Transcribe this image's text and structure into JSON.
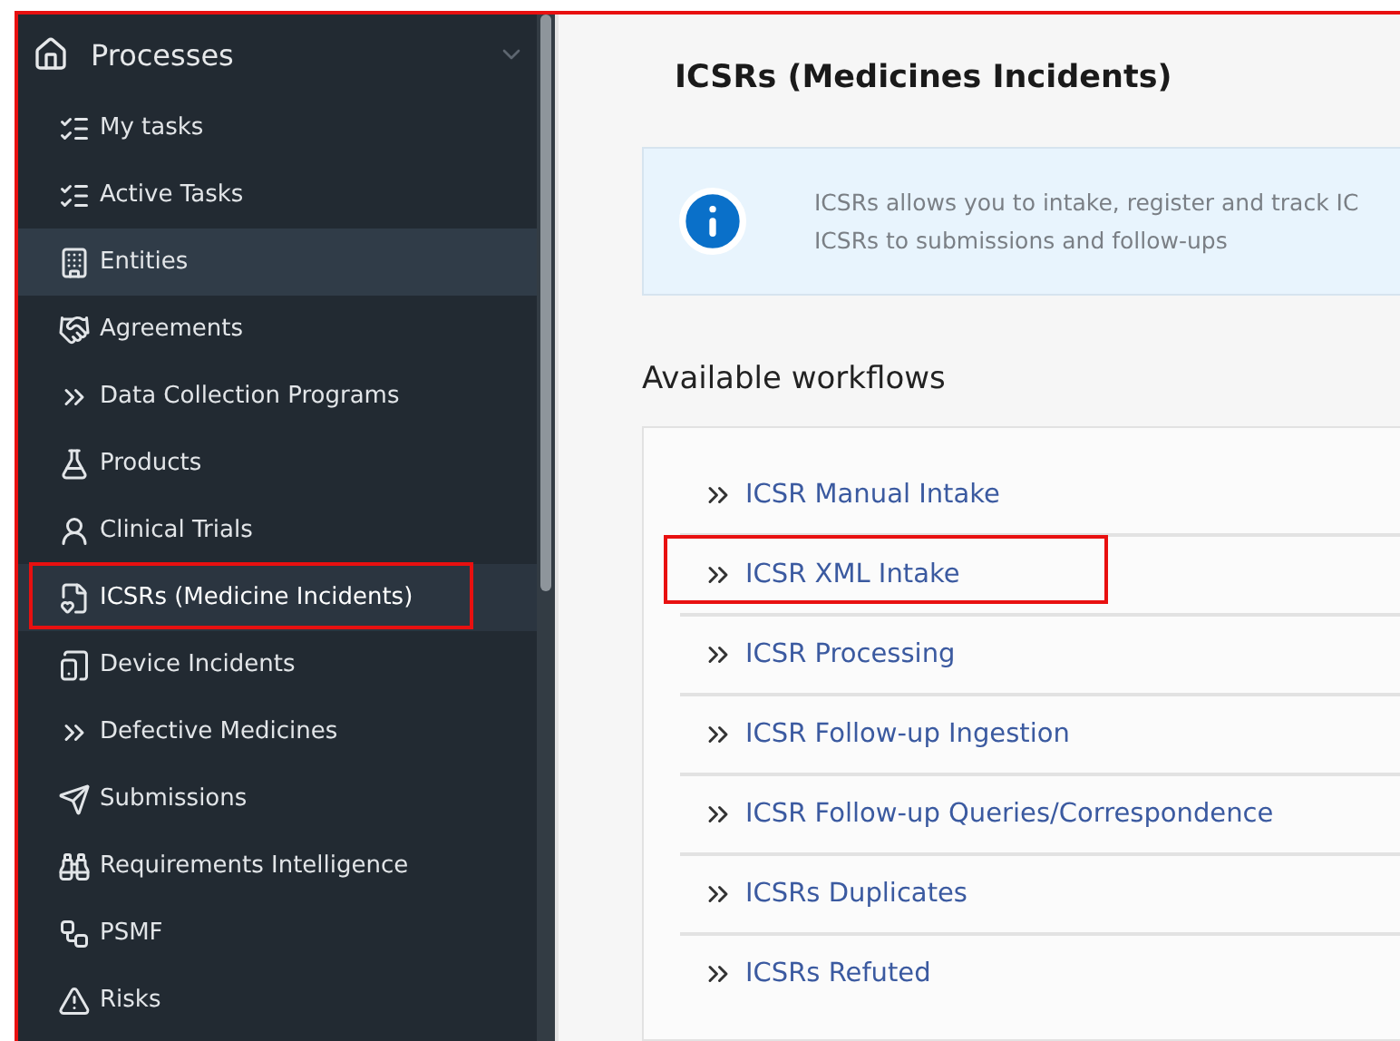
{
  "sidebar": {
    "header": "Processes",
    "expanded": true,
    "items": [
      {
        "label": "My tasks",
        "selected": false,
        "hovered": false,
        "highlighted": false
      },
      {
        "label": "Active Tasks",
        "selected": false,
        "hovered": false,
        "highlighted": false
      },
      {
        "label": "Entities",
        "selected": false,
        "hovered": true,
        "highlighted": false
      },
      {
        "label": "Agreements",
        "selected": false,
        "hovered": false,
        "highlighted": false
      },
      {
        "label": "Data Collection Programs",
        "selected": false,
        "hovered": false,
        "highlighted": false
      },
      {
        "label": "Products",
        "selected": false,
        "hovered": false,
        "highlighted": false
      },
      {
        "label": "Clinical Trials",
        "selected": false,
        "hovered": false,
        "highlighted": false
      },
      {
        "label": "ICSRs (Medicine Incidents)",
        "selected": true,
        "hovered": false,
        "highlighted": true
      },
      {
        "label": "Device Incidents",
        "selected": false,
        "hovered": false,
        "highlighted": false
      },
      {
        "label": "Defective Medicines",
        "selected": false,
        "hovered": false,
        "highlighted": false
      },
      {
        "label": "Submissions",
        "selected": false,
        "hovered": false,
        "highlighted": false
      },
      {
        "label": "Requirements Intelligence",
        "selected": false,
        "hovered": false,
        "highlighted": false
      },
      {
        "label": "PSMF",
        "selected": false,
        "hovered": false,
        "highlighted": false
      },
      {
        "label": "Risks",
        "selected": false,
        "hovered": false,
        "highlighted": false
      }
    ]
  },
  "main": {
    "title": "ICSRs (Medicines Incidents)",
    "info": {
      "lines": [
        "ICSRs allows you to intake, register and track IC",
        "ICSRs to submissions and follow-ups"
      ]
    },
    "workflows_heading": "Available workflows",
    "workflows": [
      {
        "label": "ICSR Manual Intake",
        "highlighted": false
      },
      {
        "label": "ICSR XML Intake",
        "highlighted": true
      },
      {
        "label": "ICSR Processing",
        "highlighted": false
      },
      {
        "label": "ICSR Follow-up Ingestion",
        "highlighted": false
      },
      {
        "label": "ICSR Follow-up Queries/Correspondence",
        "highlighted": false
      },
      {
        "label": "ICSRs Duplicates",
        "highlighted": false
      },
      {
        "label": "ICSRs Refuted",
        "highlighted": false
      }
    ]
  }
}
